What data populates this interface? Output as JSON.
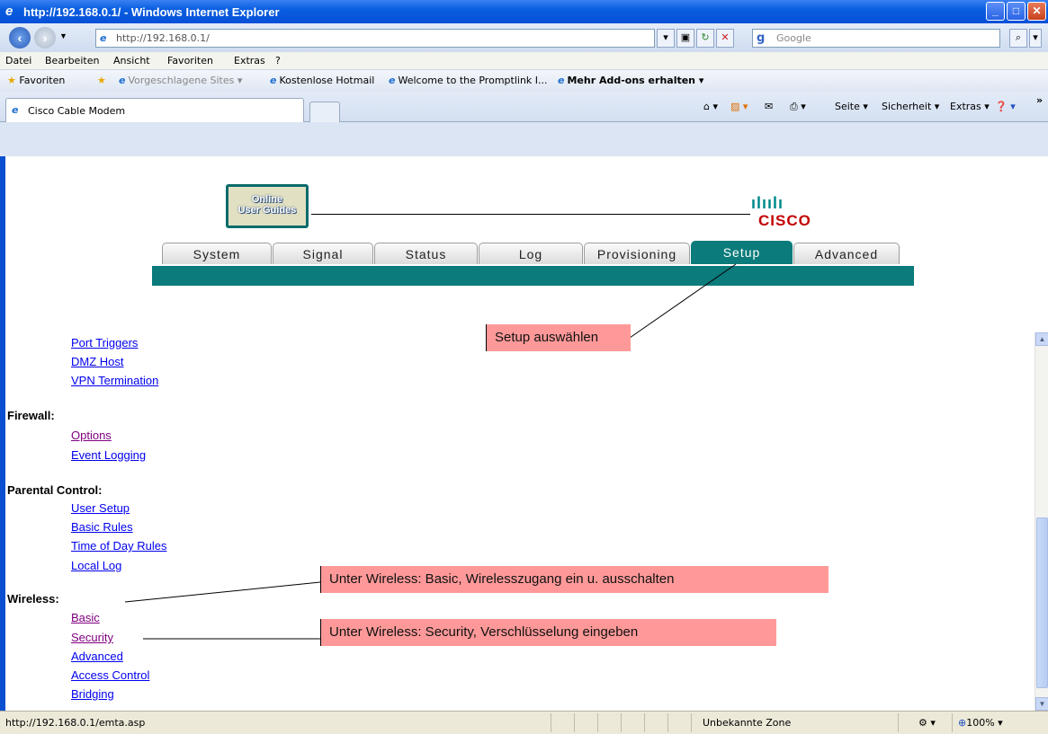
{
  "window": {
    "title": "http://192.168.0.1/ - Windows Internet Explorer"
  },
  "addressbar": {
    "url": "http://192.168.0.1/",
    "search_placeholder": "Google"
  },
  "menu": [
    "Datei",
    "Bearbeiten",
    "Ansicht",
    "Favoriten",
    "Extras",
    "?"
  ],
  "favorites": {
    "label": "Favoriten",
    "items": [
      "Vorgeschlagene Sites ▾",
      "Kostenlose Hotmail",
      "Welcome to the Promptlink I...",
      "Mehr Add-ons erhalten ▾"
    ]
  },
  "tab": {
    "title": "Cisco Cable Modem"
  },
  "commandbar": {
    "page": "Seite ▾",
    "security": "Sicherheit ▾",
    "extras": "Extras ▾"
  },
  "page": {
    "logo_text": "Online\nUser Guides",
    "brand": "CISCO",
    "nav_tabs": [
      "System",
      "Signal",
      "Status",
      "Log",
      "Provisioning",
      "Setup",
      "Advanced"
    ],
    "active_tab": "Setup",
    "links_top": [
      "Port Triggers",
      "DMZ Host",
      "VPN Termination"
    ],
    "sections": [
      {
        "heading": "Firewall:",
        "links": [
          "Options",
          "Event Logging"
        ]
      },
      {
        "heading": "Parental Control:",
        "links": [
          "User Setup",
          "Basic Rules",
          "Time of Day Rules",
          "Local Log"
        ]
      },
      {
        "heading": "Wireless:",
        "links": [
          "Basic",
          "Security",
          "Advanced",
          "Access Control",
          "Bridging"
        ]
      }
    ],
    "callouts": {
      "setup": "Setup auswählen",
      "wireless_basic": "Unter Wireless: Basic, Wirelesszugang ein u. ausschalten",
      "wireless_security": "Unter Wireless: Security, Verschlüsselung eingeben"
    }
  },
  "statusbar": {
    "url": "http://192.168.0.1/emta.asp",
    "zone": "Unbekannte Zone",
    "zoom": "100%"
  }
}
